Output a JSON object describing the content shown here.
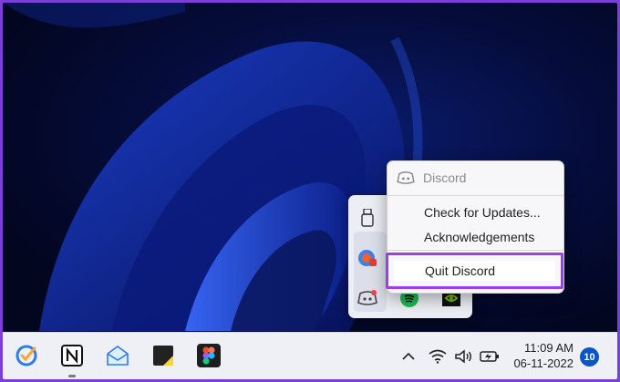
{
  "context_menu": {
    "header_label": "Discord",
    "items": [
      "Check for Updates...",
      "Acknowledgements"
    ],
    "quit_label": "Quit Discord"
  },
  "taskbar": {
    "apps": [
      "tasks-app-icon",
      "notion-app-icon",
      "mail-app-icon",
      "sticky-notes-app-icon",
      "figma-app-icon"
    ],
    "clock_time": "11:09 AM",
    "clock_date": "06-11-2022",
    "notification_count": "10"
  },
  "tray_overflow": {
    "icons": [
      "usb-drive-icon",
      "app-badge-icon",
      "discord-tray-icon",
      "spotify-icon",
      "nvidia-icon"
    ]
  },
  "colors": {
    "highlight_border": "#9b3df0",
    "notification_badge": "#0a55c4",
    "spotify": "#1db954",
    "nvidia": "#76b900",
    "discord_red_dot": "#ed4245"
  }
}
